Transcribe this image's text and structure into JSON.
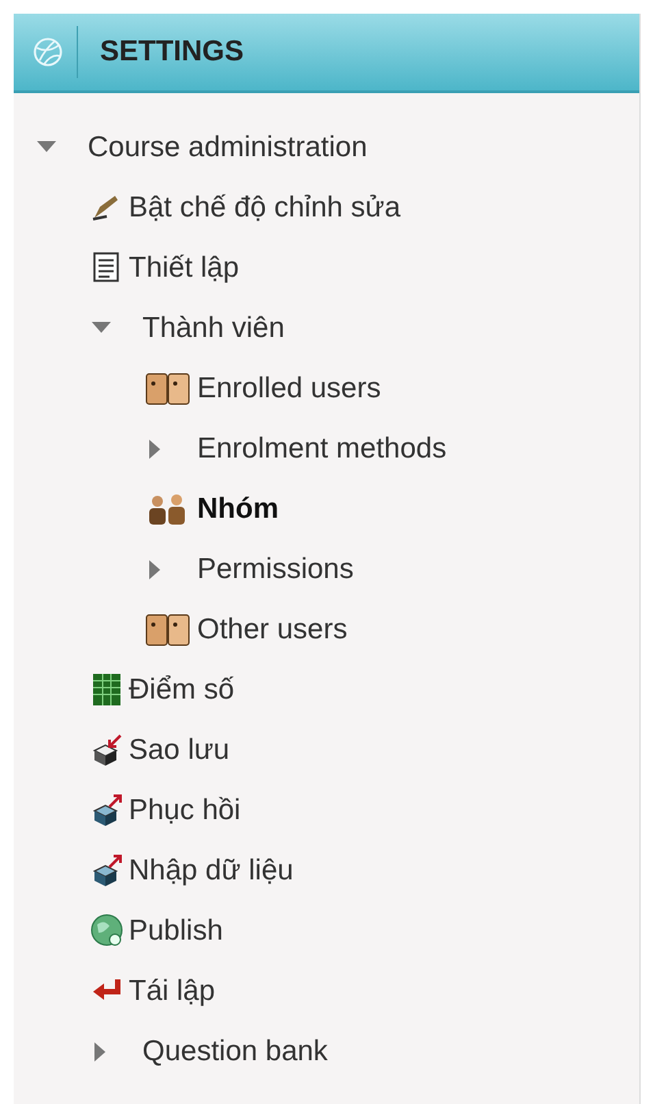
{
  "header": {
    "title": "SETTINGS"
  },
  "tree": [
    {
      "kind": "branch",
      "label": "Course administration",
      "expanded": true,
      "selected": false,
      "children": [
        {
          "kind": "pencil",
          "label": "Bật chế độ chỉnh sửa",
          "selected": false
        },
        {
          "kind": "sheet",
          "label": "Thiết lập",
          "selected": false
        },
        {
          "kind": "branch",
          "label": "Thành viên",
          "expanded": true,
          "selected": false,
          "children": [
            {
              "kind": "faces",
              "label": "Enrolled users",
              "selected": false
            },
            {
              "kind": "branch",
              "label": "Enrolment methods",
              "expanded": false,
              "selected": false
            },
            {
              "kind": "group",
              "label": "Nhóm",
              "selected": true
            },
            {
              "kind": "branch",
              "label": "Permissions",
              "expanded": false,
              "selected": false
            },
            {
              "kind": "faces",
              "label": "Other users",
              "selected": false
            }
          ]
        },
        {
          "kind": "grid",
          "label": "Điểm số",
          "selected": false
        },
        {
          "kind": "backup",
          "label": "Sao lưu",
          "selected": false
        },
        {
          "kind": "restore",
          "label": "Phục hồi",
          "selected": false
        },
        {
          "kind": "restore",
          "label": "Nhập dữ liệu",
          "selected": false
        },
        {
          "kind": "globe",
          "label": "Publish",
          "selected": false
        },
        {
          "kind": "reset",
          "label": "Tái lập",
          "selected": false
        },
        {
          "kind": "branch",
          "label": "Question bank",
          "expanded": false,
          "selected": false
        }
      ]
    }
  ]
}
